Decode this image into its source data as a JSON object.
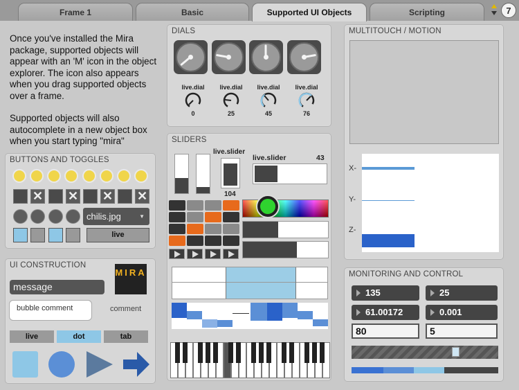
{
  "tabs": [
    {
      "label": "Frame 1"
    },
    {
      "label": "Basic"
    },
    {
      "label": "Supported UI Objects"
    },
    {
      "label": "Scripting"
    }
  ],
  "logo_glyph": "7",
  "intro": {
    "para1": "Once you've installed the Mira package, supported objects will appear with an 'M' icon in the object explorer. The icon also appears when you drag supported objects over a frame.",
    "para2": "Supported objects will also autocomplete in a new object box when you start typing \"mira\""
  },
  "dials": {
    "title": "DIALS",
    "live_dials": [
      {
        "label": "live.dial",
        "value": "0"
      },
      {
        "label": "live.dial",
        "value": "25"
      },
      {
        "label": "live.dial",
        "value": "45"
      },
      {
        "label": "live.dial",
        "value": "76"
      }
    ]
  },
  "sliders": {
    "title": "SLIDERS",
    "vertical_label": "live.slider",
    "vertical_value": "104",
    "horizontal_label": "live.slider",
    "horizontal_value": "43"
  },
  "multitouch": {
    "title": "MULTITOUCH / MOTION",
    "axes": [
      "X-",
      "Y-",
      "Z-"
    ]
  },
  "buttons": {
    "title": "BUTTONS AND TOGGLES",
    "menu_value": "chilis.jpg",
    "live_button": "live"
  },
  "construction": {
    "title": "UI CONSTRUCTION",
    "message": "message",
    "bubble": "bubble comment",
    "comment": "comment",
    "tabs": [
      "live",
      "dot",
      "tab"
    ],
    "mira_logo": "MIRA"
  },
  "monitoring": {
    "title": "MONITORING AND CONTROL",
    "num1": "135",
    "num2": "25",
    "flo1": "61.00172",
    "flo2": "0.001",
    "box1": "80",
    "box2": "5"
  },
  "colors": {
    "accent_blue": "#5b8fd6",
    "light_blue": "#8ec7e6",
    "yellow": "#f0d54a",
    "orange": "#e76a1c"
  }
}
